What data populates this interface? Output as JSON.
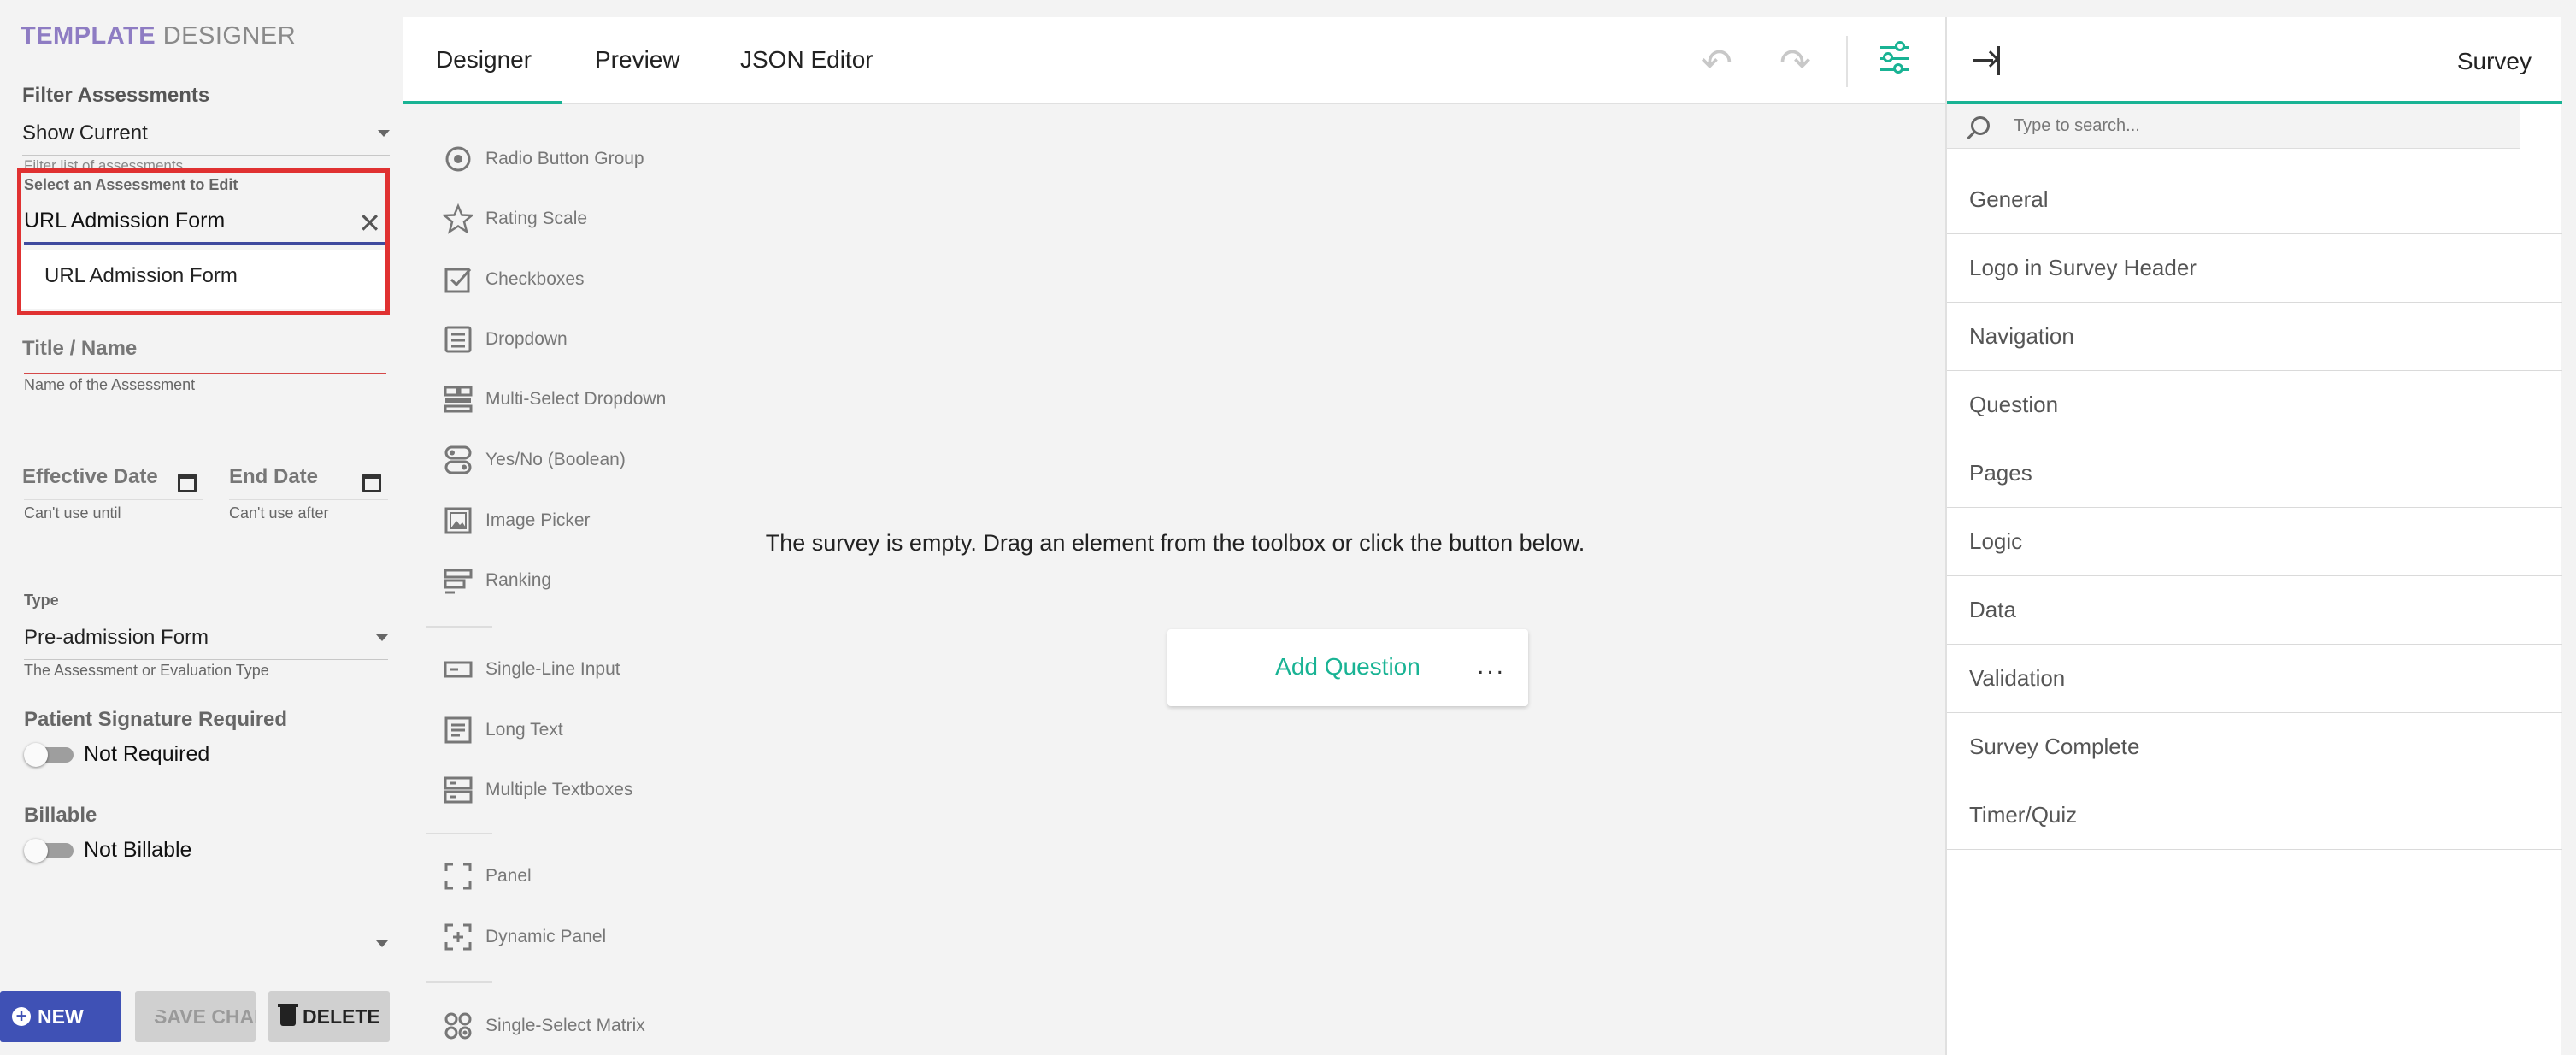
{
  "app": {
    "title_a": "TEMPLATE",
    "title_b": "DESIGNER"
  },
  "left": {
    "filter_label": "Filter Assessments",
    "filter_value": "Show Current",
    "filter_helper": "Filter list of assessments",
    "assessment_label": "Select an Assessment to Edit",
    "assessment_value": "URL Admission Form",
    "assessment_option": "URL Admission Form",
    "title_label": "Title / Name",
    "title_helper": "Name of the Assessment",
    "effective_label": "Effective Date",
    "effective_helper": "Can't use until",
    "end_label": "End Date",
    "end_helper": "Can't use after",
    "type_label": "Type",
    "type_value": "Pre-admission Form",
    "type_helper": "The Assessment or Evaluation Type",
    "signature_label": "Patient Signature Required",
    "signature_toggle": "Not Required",
    "billable_label": "Billable",
    "billable_toggle": "Not Billable",
    "buttons": {
      "new": "NEW",
      "save": "SAVE CHANGES",
      "delete": "DELETE"
    }
  },
  "center": {
    "tabs": [
      "Designer",
      "Preview",
      "JSON Editor"
    ],
    "toolbox": [
      {
        "label": "Radio Button Group",
        "icon": "radio-group-icon"
      },
      {
        "label": "Rating Scale",
        "icon": "star-icon"
      },
      {
        "label": "Checkboxes",
        "icon": "checkbox-icon"
      },
      {
        "label": "Dropdown",
        "icon": "dropdown-icon"
      },
      {
        "label": "Multi-Select Dropdown",
        "icon": "tagbox-icon"
      },
      {
        "label": "Yes/No (Boolean)",
        "icon": "boolean-icon"
      },
      {
        "label": "Image Picker",
        "icon": "image-picker-icon"
      },
      {
        "label": "Ranking",
        "icon": "ranking-icon"
      },
      {
        "label": "Single-Line Input",
        "icon": "text-input-icon"
      },
      {
        "label": "Long Text",
        "icon": "comment-icon"
      },
      {
        "label": "Multiple Textboxes",
        "icon": "multiple-text-icon"
      },
      {
        "label": "Panel",
        "icon": "panel-icon"
      },
      {
        "label": "Dynamic Panel",
        "icon": "dynamic-panel-icon"
      },
      {
        "label": "Single-Select Matrix",
        "icon": "matrix-icon"
      }
    ],
    "empty_message": "The survey is empty. Drag an element from the toolbox or click the button below.",
    "add_question": "Add Question",
    "more": "..."
  },
  "right": {
    "title": "Survey",
    "search_placeholder": "Type to search...",
    "categories": [
      "General",
      "Logo in Survey Header",
      "Navigation",
      "Question",
      "Pages",
      "Logic",
      "Data",
      "Validation",
      "Survey Complete",
      "Timer/Quiz"
    ]
  },
  "colors": {
    "accent": "#19b394",
    "primary": "#3f51b5",
    "brand": "#8e7cc3",
    "error": "#e03131"
  }
}
